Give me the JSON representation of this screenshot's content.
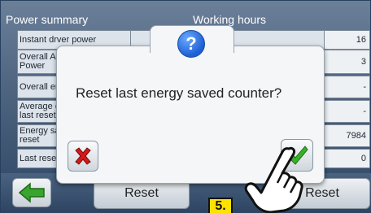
{
  "header": {
    "left_title": "Power summary",
    "right_title": "Working hours"
  },
  "table": {
    "rows": [
      {
        "label": "Instant drver power",
        "value": "16"
      },
      {
        "label": "Overall A\nPower",
        "value": "3"
      },
      {
        "label": "Overall er",
        "value": "-"
      },
      {
        "label": "Average c\nlast reset",
        "value": "-"
      },
      {
        "label": "Energy sa\nreset",
        "value": "7984"
      },
      {
        "label": "Last rese",
        "value": "0"
      }
    ]
  },
  "bottom_bar": {
    "reset_left_label": "Reset",
    "reset_right_label": "Reset"
  },
  "dialog": {
    "icon": "question-icon",
    "icon_text": "?",
    "message": "Reset last energy saved counter?",
    "cancel_icon": "red-x-icon",
    "confirm_icon": "green-check-icon"
  },
  "step_badge": {
    "text": "5."
  },
  "colors": {
    "accent_blue": "#1c5fd4",
    "cancel_red": "#d11a1a",
    "confirm_green": "#38b12a",
    "badge_yellow": "#ffe100"
  }
}
